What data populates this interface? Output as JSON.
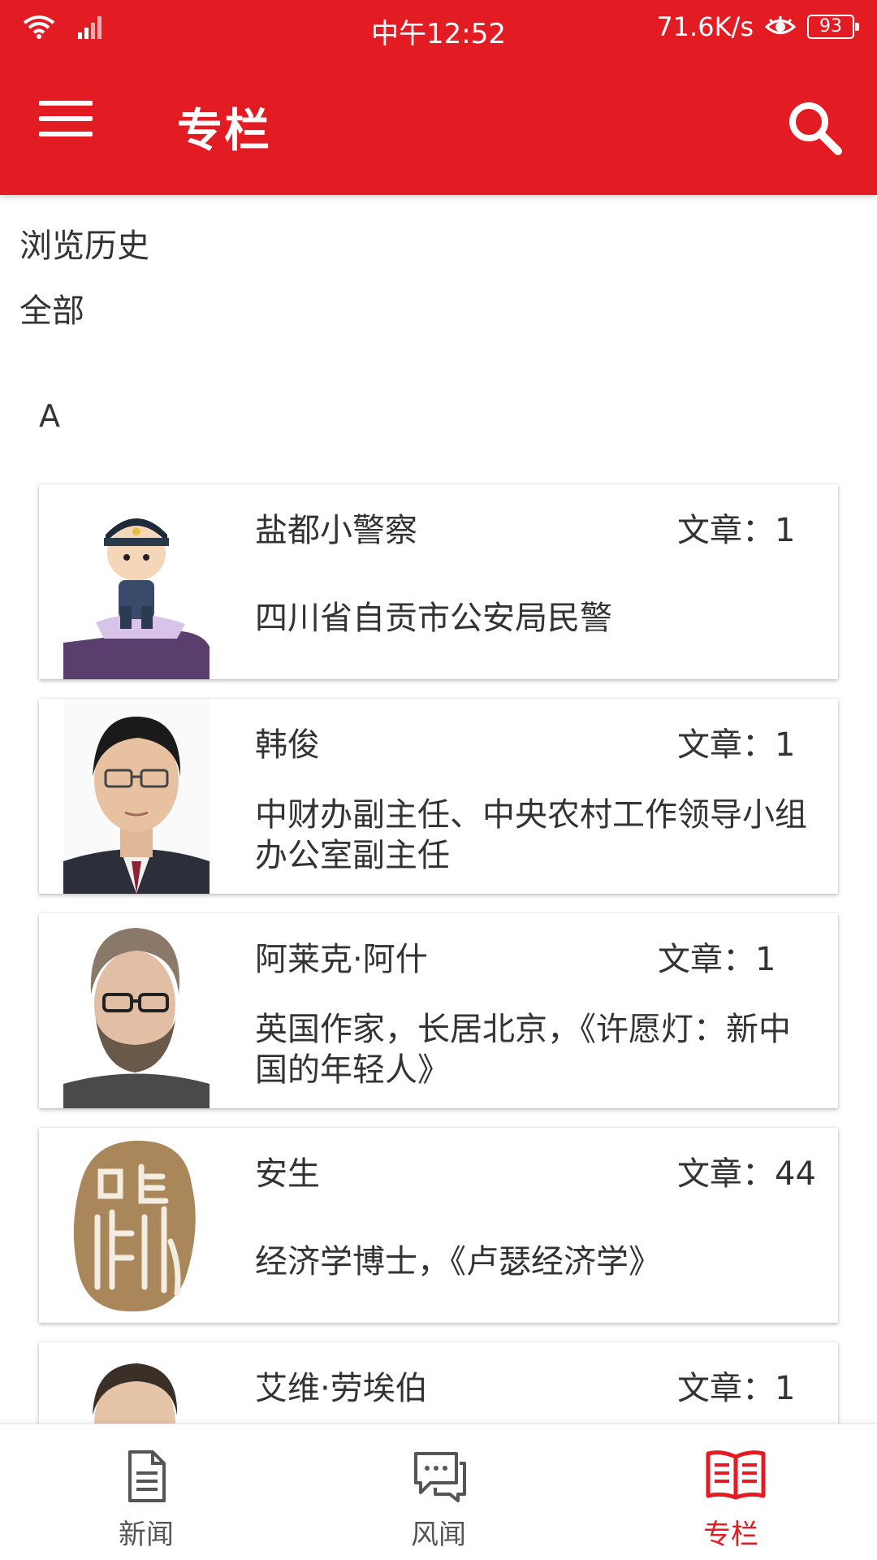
{
  "status_bar": {
    "time": "中午12:52",
    "speed": "71.6K/s",
    "battery": "93"
  },
  "toolbar": {
    "title": "专栏"
  },
  "links": {
    "history": "浏览历史",
    "all": "全部"
  },
  "section": {
    "letter": "A"
  },
  "cards": [
    {
      "name": "盐都小警察",
      "count": "文章：1",
      "desc": "四川省自贡市公安局民警"
    },
    {
      "name": "韩俊",
      "count": "文章：1",
      "desc": "中财办副主任、中央农村工作领导小组办公室副主任"
    },
    {
      "name": "阿莱克·阿什",
      "count": "文章：1",
      "desc": "英国作家，长居北京，《许愿灯：新中国的年轻人》"
    },
    {
      "name": "安生",
      "count": "文章：44",
      "desc": "经济学博士，《卢瑟经济学》"
    },
    {
      "name": "艾维·劳埃伯",
      "count": "文章：1",
      "desc": ""
    }
  ],
  "bottom_nav": [
    {
      "label": "新闻",
      "icon": "document-icon",
      "active": false
    },
    {
      "label": "风闻",
      "icon": "chat-icon",
      "active": false
    },
    {
      "label": "专栏",
      "icon": "book-icon",
      "active": true
    }
  ],
  "colors": {
    "brand": "#e31b23"
  }
}
